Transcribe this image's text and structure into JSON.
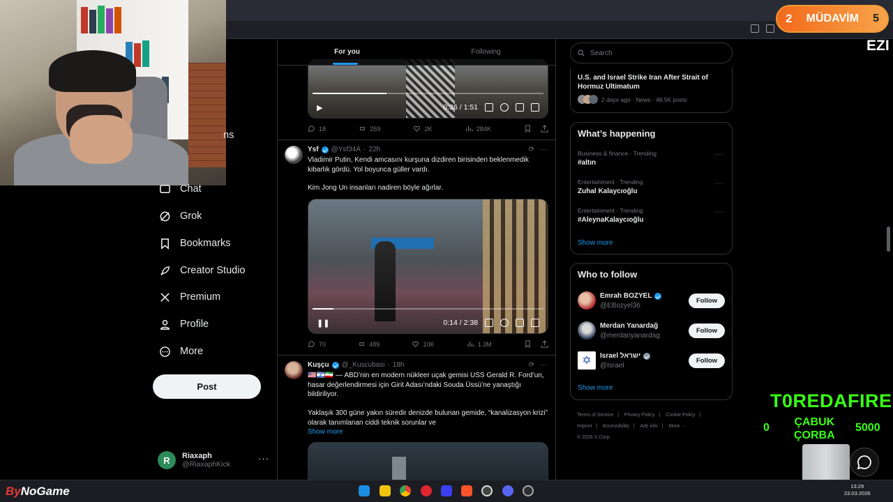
{
  "timeline": {
    "tabs": [
      {
        "label": "For you"
      },
      {
        "label": "Following"
      }
    ],
    "tweets": [
      {
        "video_time": "0:36 / 1:51",
        "video_progress": 0.32,
        "stats": {
          "replies": "18",
          "reposts": "259",
          "likes": "2K",
          "views": "284K"
        }
      },
      {
        "name": "Ysf",
        "handle": "@Ysf34A",
        "time": "22h",
        "text1": "Vladimir Putin, Kendi amcasını kurşuna dizdiren birisinden beklenmedik kibarlık gördü. Yol boyunca güller vardı.",
        "text2": "Kim Jong Un insanları nadiren böyle ağırlar.",
        "video_time": "0:14 / 2:38",
        "video_progress": 0.09,
        "stats": {
          "replies": "70",
          "reposts": "489",
          "likes": "10K",
          "views": "1.3M"
        }
      },
      {
        "name": "Kuşçu",
        "handle": "@_Kuscubasi",
        "time": "18h",
        "flags": "🇺🇸🇮🇱🇮🇷",
        "text1": "— ABD’nin en modern nükleer uçak gemisi USS Gerald R. Ford’un, hasar değerlendirmesi için Girit Adası’ndaki Souda Üssü’ne yanaştığı bildiriliyor.",
        "text2": "Yaklaşık 300 güne yakın süredir denizde bulunan gemide, “kanalizasyon krizi” olarak tanımlanan ciddi teknik sorunlar ve",
        "show_more": "Show more"
      }
    ]
  },
  "nav": {
    "partial_text": "ns",
    "items": [
      {
        "label": "Chat",
        "icon": "chat-icon"
      },
      {
        "label": "Grok",
        "icon": "grok-icon"
      },
      {
        "label": "Bookmarks",
        "icon": "bookmark-icon"
      },
      {
        "label": "Creator Studio",
        "icon": "rocket-icon"
      },
      {
        "label": "Premium",
        "icon": "x-logo-icon"
      },
      {
        "label": "Profile",
        "icon": "person-icon"
      },
      {
        "label": "More",
        "icon": "more-circle-icon"
      }
    ],
    "post_label": "Post",
    "account": {
      "initial": "R",
      "name": "Riaxaph",
      "handle": "@RiaxaphKick",
      "more": "···"
    }
  },
  "right": {
    "search_placeholder": "Search",
    "news": {
      "headline": "U.S. and Israel Strike Iran After Strait of Hormuz Ultimatum",
      "meta": "2 days ago · News · 48.5K posts"
    },
    "whats_happening": {
      "title": "What’s happening",
      "trends": [
        {
          "category": "Business & finance · Trending",
          "name": "#altın"
        },
        {
          "category": "Entertainment · Trending",
          "name": "Zuhal Kalaycıoğlu"
        },
        {
          "category": "Entertainment · Trending",
          "name": "#AleynaKalaycıoğlu"
        }
      ],
      "show_more": "Show more"
    },
    "who_to_follow": {
      "title": "Who to follow",
      "accounts": [
        {
          "name": "Emrah BOZYEL",
          "handle": "@EBozyel36",
          "follow": "Follow"
        },
        {
          "name": "Merdan Yanardağ",
          "handle": "@merdanyanardag",
          "follow": "Follow"
        },
        {
          "name": "Israel ישראל",
          "handle": "@Israel",
          "follow": "Follow"
        }
      ],
      "show_more": "Show more"
    },
    "footer": {
      "links": [
        "Terms of Service",
        "|",
        "Privacy Policy",
        "|",
        "Cookie Policy",
        "|",
        "Imprint",
        "|",
        "Accessibility",
        "|",
        "Ads info",
        "|",
        "More ···"
      ],
      "copyright": "© 2026 X Corp."
    }
  },
  "overlay": {
    "mudavim": {
      "left": "2",
      "label": "MÜDAVİM",
      "right": "5"
    },
    "ezi": "EZI",
    "toredafire": "T0REDAFIRE",
    "cabuk": "ÇABUK",
    "corba": "ÇORBA",
    "count_left": "0",
    "count_right": "5000"
  },
  "taskbar": {
    "brand_prefix": "By",
    "brand_suffix": "NoGame",
    "time": "13:29",
    "date": "23.03.2026"
  },
  "colors": {
    "accent": "#1d9bf0",
    "background": "#000000",
    "overlay_green": "#39ff14",
    "overlay_orange": "#f26a1b"
  }
}
